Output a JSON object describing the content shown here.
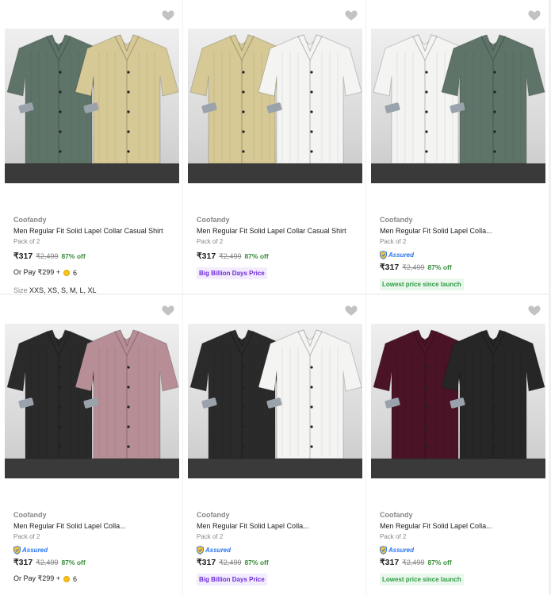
{
  "icons": {
    "wishlist": "heart-icon",
    "coin": "supercoin-icon",
    "assured": "assured-shield-icon"
  },
  "colors": {
    "discount": "#388e3c",
    "bbd_badge": "#6f2bd8",
    "lowest_badge": "#2e9b43",
    "assured": "#2874f0"
  },
  "products": [
    {
      "brand": "Coofandy",
      "title": "Men Regular Fit Solid Lapel Collar Casual Shirt",
      "pack": "Pack of 2",
      "price": "₹317",
      "mrp": "₹2,499",
      "off": "87% off",
      "or_pay_text": "Or Pay ₹299 +",
      "or_pay_coins": "6",
      "size_label": "Size",
      "sizes": "XXS, XS, S, M, L, XL",
      "shirt_colors": [
        "#5e7468",
        "#d6c996"
      ]
    },
    {
      "brand": "Coofandy",
      "title": "Men Regular Fit Solid Lapel Collar Casual Shirt",
      "pack": "Pack of 2",
      "price": "₹317",
      "mrp": "₹2,499",
      "off": "87% off",
      "badge": "Big Billion Days Price",
      "shirt_colors": [
        "#d6c996",
        "#f4f4f2"
      ]
    },
    {
      "brand": "Coofandy",
      "title": "Men Regular Fit Solid Lapel Colla...",
      "pack": "Pack of 2",
      "assured": "Assured",
      "price": "₹317",
      "mrp": "₹2,499",
      "off": "87% off",
      "badge": "Lowest price since launch",
      "shirt_colors": [
        "#f4f4f2",
        "#5e7468"
      ]
    },
    {
      "brand": "Coofandy",
      "title": "Men Regular Fit Solid Lapel Colla...",
      "pack": "Pack of 2",
      "assured": "Assured",
      "price": "₹317",
      "mrp": "₹2,499",
      "off": "87% off",
      "or_pay_text": "Or Pay ₹299 +",
      "or_pay_coins": "6",
      "shirt_colors": [
        "#2a2a2a",
        "#b78e96"
      ]
    },
    {
      "brand": "Coofandy",
      "title": "Men Regular Fit Solid Lapel Colla...",
      "pack": "Pack of 2",
      "assured": "Assured",
      "price": "₹317",
      "mrp": "₹2,499",
      "off": "87% off",
      "badge": "Big Billion Days Price",
      "shirt_colors": [
        "#2a2a2a",
        "#f4f4f2"
      ]
    },
    {
      "brand": "Coofandy",
      "title": "Men Regular Fit Solid Lapel Colla...",
      "pack": "Pack of 2",
      "assured": "Assured",
      "price": "₹317",
      "mrp": "₹2,499",
      "off": "87% off",
      "badge": "Lowest price since launch",
      "shirt_colors": [
        "#4a1426",
        "#262626"
      ]
    }
  ]
}
